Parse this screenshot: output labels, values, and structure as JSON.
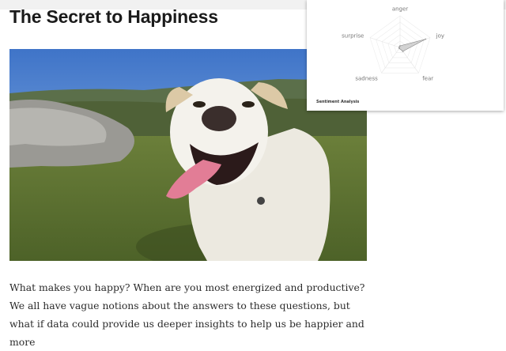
{
  "article": {
    "title": "The Secret to Happiness",
    "body": "What makes you happy? When are you most energized and productive? We all have vague notions about the answers to these questions, but what if data could provide us deeper insights to help us be happier and more"
  },
  "extension": {
    "title": "Sentiment Analysis",
    "chart_data": {
      "type": "radar",
      "categories": [
        "anger",
        "joy",
        "fear",
        "sadness",
        "surprise"
      ],
      "values": [
        0.05,
        0.85,
        0.15,
        0.04,
        0.03
      ],
      "range": [
        0,
        1
      ],
      "grid": true,
      "legend": "none",
      "fill_color": "#c8c8c8",
      "stroke_color": "#888888"
    }
  }
}
